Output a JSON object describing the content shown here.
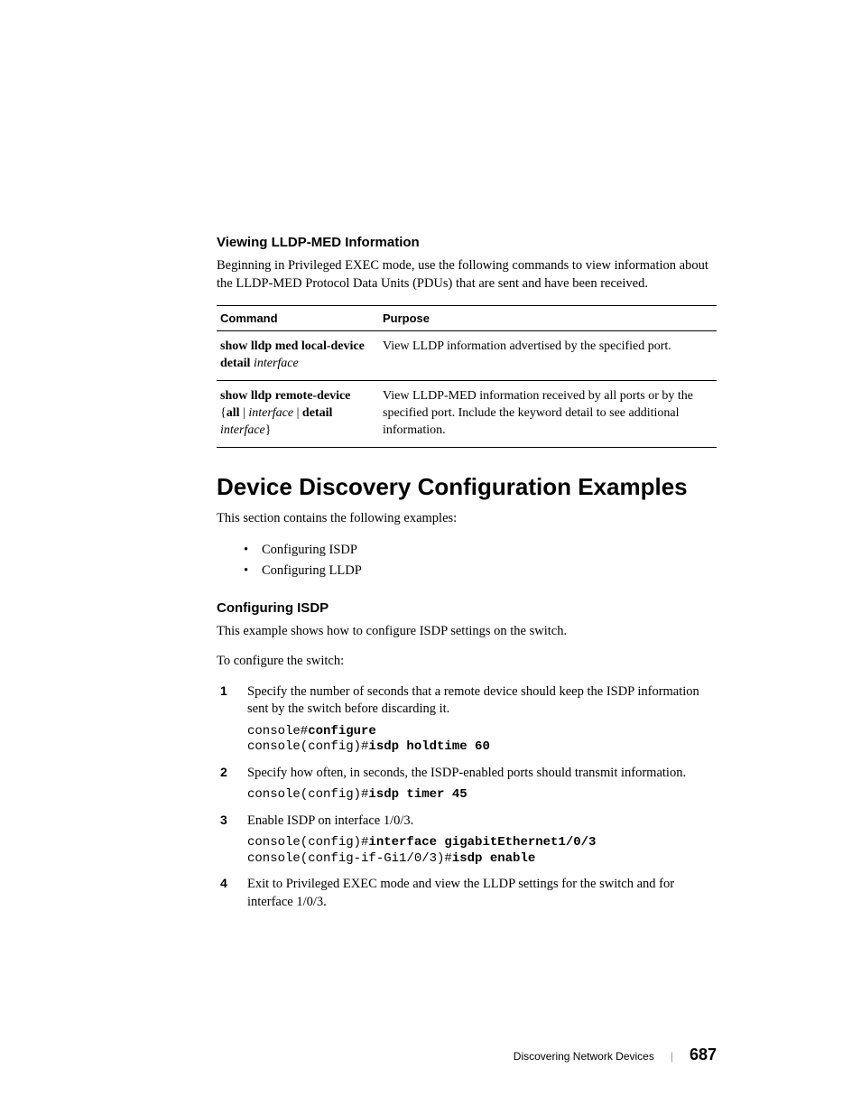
{
  "section1": {
    "heading": "Viewing LLDP-MED Information",
    "intro": "Beginning in Privileged EXEC mode, use the following commands to view information about the LLDP-MED Protocol Data Units (PDUs) that are sent and have been received."
  },
  "table": {
    "headers": {
      "col1": "Command",
      "col2": "Purpose"
    },
    "rows": [
      {
        "cmd_a": "show lldp med local-device detail ",
        "cmd_b": "interface",
        "purpose": "View LLDP information advertised by the specified port."
      },
      {
        "cmd_a": "show lldp remote-device",
        "cmd_b_pre": "{",
        "cmd_b_all": "all",
        "cmd_b_mid": " | ",
        "cmd_b_if": "interface",
        "cmd_b_mid2": " | ",
        "cmd_b_detail": "detail ",
        "cmd_b_if2": "interface",
        "cmd_b_post": "}",
        "purpose": "View LLDP-MED information received by all ports or by the specified port. Include the keyword detail to see additional information."
      }
    ]
  },
  "section2": {
    "title": "Device Discovery Configuration Examples",
    "intro": "This section contains the following examples:",
    "bullets": [
      "Configuring ISDP",
      "Configuring LLDP"
    ]
  },
  "section3": {
    "heading": "Configuring ISDP",
    "intro1": "This example shows how to configure ISDP settings on the switch.",
    "intro2": "To configure the switch:",
    "steps": [
      {
        "text": "Specify the number of seconds that a remote device should keep the ISDP information sent by the switch before discarding it.",
        "code": [
          {
            "p": "console#",
            "k": "configure"
          },
          {
            "p": "console(config)#",
            "k": "isdp holdtime 60"
          }
        ]
      },
      {
        "text": "Specify how often, in seconds, the ISDP-enabled ports should transmit information.",
        "code": [
          {
            "p": "console(config)#",
            "k": "isdp timer 45"
          }
        ]
      },
      {
        "text": "Enable ISDP on interface 1/0/3.",
        "code": [
          {
            "p": "console(config)#",
            "k": "interface gigabitEthernet1/0/3"
          },
          {
            "p": "console(config-if-Gi1/0/3)#",
            "k": "isdp enable"
          }
        ]
      },
      {
        "text": "Exit to Privileged EXEC mode and view the LLDP settings for the switch and for interface 1/0/3.",
        "code": []
      }
    ]
  },
  "footer": {
    "chapter": "Discovering Network Devices",
    "page": "687"
  }
}
